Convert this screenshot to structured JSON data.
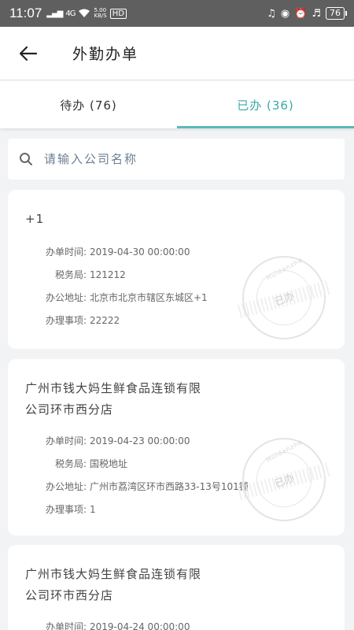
{
  "status_bar": {
    "time": "11:07",
    "network": "4G",
    "speed_top": "5.00",
    "speed_bottom": "KB/S",
    "hd": "HD",
    "battery": "76"
  },
  "header": {
    "title": "外勤办单"
  },
  "tabs": [
    {
      "label": "待办 (76)",
      "active": false
    },
    {
      "label": "已办 (36)",
      "active": true
    }
  ],
  "search": {
    "placeholder": "请输入公司名称"
  },
  "field_labels": {
    "time": "办单时间:",
    "tax_bureau": "税务局:",
    "address": "办公地址:",
    "matter": "办理事项:"
  },
  "stamp": {
    "text": "已办",
    "arc": "Huidanzhe"
  },
  "cards": [
    {
      "company": "+1",
      "time": "2019-04-30 00:00:00",
      "tax_bureau": "121212",
      "address": "北京市北京市辖区东城区+1",
      "matter": "22222"
    },
    {
      "company": "广州市钱大妈生鲜食品连锁有限公司环市西分店",
      "time": "2019-04-23 00:00:00",
      "tax_bureau": "国税地址",
      "address": "广州市荔湾区环市西路33-13号101铺",
      "matter": "1"
    },
    {
      "company": "广州市钱大妈生鲜食品连锁有限公司环市西分店",
      "time": "2019-04-24 00:00:00"
    }
  ],
  "colors": {
    "accent": "#3aa9a6",
    "status_bar": "#5f5f5f"
  }
}
